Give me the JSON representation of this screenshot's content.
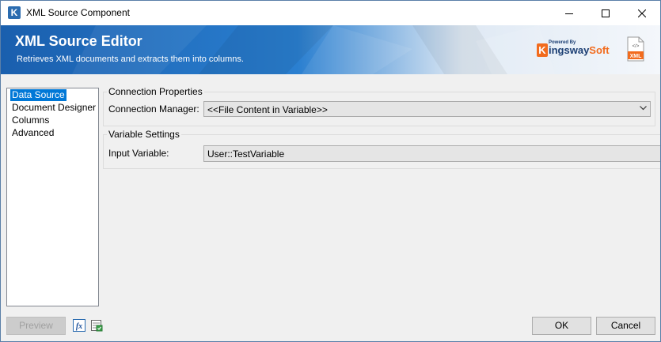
{
  "window": {
    "title": "XML Source Component",
    "app_icon_letter": "K"
  },
  "banner": {
    "title": "XML Source Editor",
    "subtitle": "Retrieves XML documents and extracts them into columns.",
    "brand": {
      "powered_by": "Powered By",
      "logo_letter": "K",
      "name_part1": "ingsway",
      "name_part2": "Soft"
    },
    "file_icon_label": "XML",
    "file_icon_glyph": "</>",
    "colors": {
      "banner_blue": "#1f6fc0",
      "brand_orange": "#f26b1d",
      "brand_navy": "#1b3e73"
    }
  },
  "nav": {
    "items": [
      {
        "label": "Data Source",
        "selected": true
      },
      {
        "label": "Document Designer",
        "selected": false
      },
      {
        "label": "Columns",
        "selected": false
      },
      {
        "label": "Advanced",
        "selected": false
      }
    ]
  },
  "connection": {
    "group_label": "Connection Properties",
    "manager_label": "Connection Manager:",
    "manager_value": "<<File Content in Variable>>"
  },
  "variables": {
    "group_label": "Variable Settings",
    "input_label": "Input Variable:",
    "input_value": "User::TestVariable"
  },
  "footer": {
    "preview_label": "Preview",
    "fx_icon": "fx",
    "ok_label": "OK",
    "cancel_label": "Cancel"
  }
}
